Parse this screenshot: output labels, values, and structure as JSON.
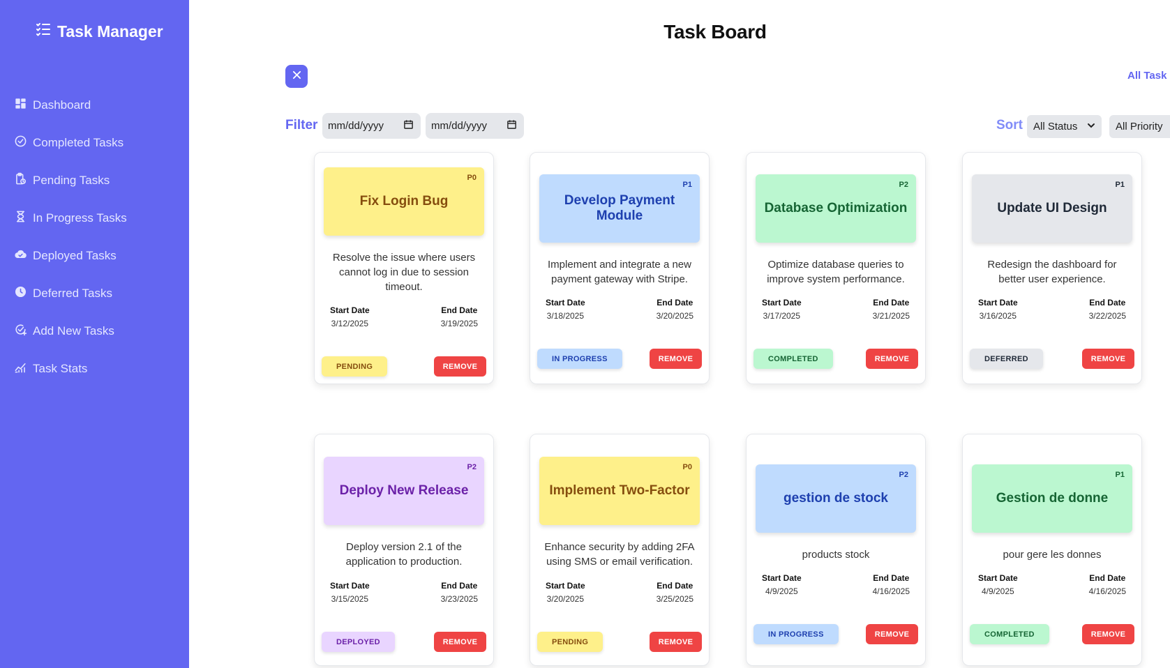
{
  "sidebar": {
    "brand": "Task Manager",
    "items": [
      {
        "label": "Dashboard",
        "icon": "dashboard-icon"
      },
      {
        "label": "Completed Tasks",
        "icon": "check-circle-icon"
      },
      {
        "label": "Pending Tasks",
        "icon": "clipboard-clock-icon"
      },
      {
        "label": "In Progress Tasks",
        "icon": "hourglass-icon"
      },
      {
        "label": "Deployed Tasks",
        "icon": "cloud-check-icon"
      },
      {
        "label": "Deferred Tasks",
        "icon": "clock-icon"
      },
      {
        "label": "Add New Tasks",
        "icon": "add-task-icon"
      },
      {
        "label": "Task Stats",
        "icon": "chart-line-icon"
      }
    ]
  },
  "main": {
    "title": "Task Board",
    "all_tasks_link": "All Task (",
    "filter_label": "Filter",
    "date_placeholder_start": "mm/dd/yyyy",
    "date_placeholder_end": "mm/dd/yyyy",
    "sort_label": "Sort",
    "status_select": "All Status",
    "priority_select": "All Priority"
  },
  "labels": {
    "start": "Start Date",
    "end": "End Date",
    "remove": "REMOVE"
  },
  "tasks": [
    {
      "title": "Fix Login Bug",
      "priority": "P0",
      "description": "Resolve the issue where users cannot log in due to session timeout.",
      "start": "3/12/2025",
      "end": "3/19/2025",
      "status": "PENDING"
    },
    {
      "title": "Develop Payment Module",
      "priority": "P1",
      "description": "Implement and integrate a new payment gateway with Stripe.",
      "start": "3/18/2025",
      "end": "3/20/2025",
      "status": "IN PROGRESS"
    },
    {
      "title": "Database Optimization",
      "priority": "P2",
      "description": "Optimize database queries to improve system performance.",
      "start": "3/17/2025",
      "end": "3/21/2025",
      "status": "COMPLETED"
    },
    {
      "title": "Update UI Design",
      "priority": "P1",
      "description": "Redesign the dashboard for better user experience.",
      "start": "3/16/2025",
      "end": "3/22/2025",
      "status": "DEFERRED"
    },
    {
      "title": "Deploy New Release",
      "priority": "P2",
      "description": "Deploy version 2.1 of the application to production.",
      "start": "3/15/2025",
      "end": "3/23/2025",
      "status": "DEPLOYED"
    },
    {
      "title": "Implement Two-Factor",
      "priority": "P0",
      "description": "Enhance security by adding 2FA using SMS or email verification.",
      "start": "3/20/2025",
      "end": "3/25/2025",
      "status": "PENDING"
    },
    {
      "title": "gestion de stock",
      "priority": "P2",
      "description": "products stock",
      "start": "4/9/2025",
      "end": "4/16/2025",
      "status": "IN PROGRESS"
    },
    {
      "title": "Gestion de donne",
      "priority": "P1",
      "description": "pour gere les donnes",
      "start": "4/9/2025",
      "end": "4/16/2025",
      "status": "COMPLETED"
    }
  ],
  "colors": {
    "sidebar": "#6366f1",
    "accent": "#6366f1",
    "remove": "#ef4444",
    "pending": "#fef08a",
    "in_progress": "#bfdbfe",
    "completed": "#bbf7d0",
    "deferred": "#e5e7eb",
    "deployed": "#e9d5ff"
  }
}
